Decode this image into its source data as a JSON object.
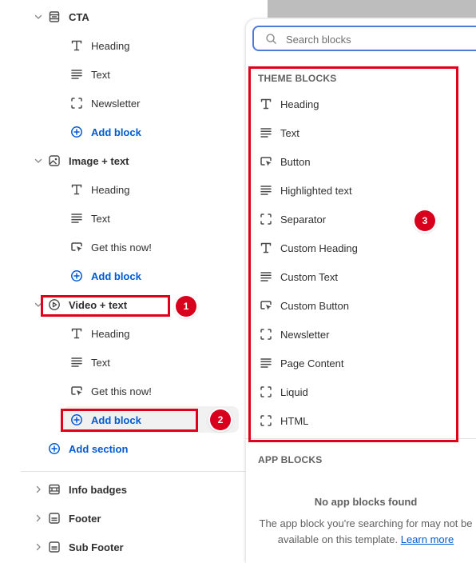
{
  "tree": {
    "sections": [
      {
        "label": "CTA",
        "icon": "section-icon",
        "blocks": [
          {
            "label": "Heading",
            "icon": "heading-icon"
          },
          {
            "label": "Text",
            "icon": "text-icon"
          },
          {
            "label": "Newsletter",
            "icon": "dashed-square-icon"
          }
        ]
      },
      {
        "label": "Image + text",
        "icon": "image-icon",
        "blocks": [
          {
            "label": "Heading",
            "icon": "heading-icon"
          },
          {
            "label": "Text",
            "icon": "text-icon"
          },
          {
            "label": "Get this now!",
            "icon": "button-icon"
          }
        ]
      },
      {
        "label": "Video + text",
        "icon": "video-icon",
        "blocks": [
          {
            "label": "Heading",
            "icon": "heading-icon"
          },
          {
            "label": "Text",
            "icon": "text-icon"
          },
          {
            "label": "Get this now!",
            "icon": "button-icon"
          }
        ]
      }
    ],
    "add_block_label": "Add block",
    "add_section_label": "Add section",
    "footer_sections": [
      {
        "label": "Info badges"
      },
      {
        "label": "Footer"
      },
      {
        "label": "Sub Footer"
      }
    ]
  },
  "popover": {
    "search_placeholder": "Search blocks",
    "theme_blocks_header": "THEME BLOCKS",
    "theme_blocks": [
      {
        "label": "Heading",
        "icon": "heading-icon"
      },
      {
        "label": "Text",
        "icon": "text-icon"
      },
      {
        "label": "Button",
        "icon": "button-icon"
      },
      {
        "label": "Highlighted text",
        "icon": "text-icon"
      },
      {
        "label": "Separator",
        "icon": "dashed-square-icon"
      },
      {
        "label": "Custom Heading",
        "icon": "heading-icon"
      },
      {
        "label": "Custom Text",
        "icon": "text-icon"
      },
      {
        "label": "Custom Button",
        "icon": "button-icon"
      },
      {
        "label": "Newsletter",
        "icon": "dashed-square-icon"
      },
      {
        "label": "Page Content",
        "icon": "text-icon"
      },
      {
        "label": "Liquid",
        "icon": "dashed-square-icon"
      },
      {
        "label": "HTML",
        "icon": "dashed-square-icon"
      }
    ],
    "app_blocks_header": "APP BLOCKS",
    "empty_title": "No app blocks found",
    "empty_text": "The app block you're searching for may not be available on this template.",
    "learn_more_label": "Learn more"
  },
  "annotations": {
    "badge_1": "1",
    "badge_2": "2",
    "badge_3": "3"
  },
  "colors": {
    "accent": "#005bd3",
    "annotation_red": "#e0001b",
    "search_focus": "#4f7bd8"
  }
}
